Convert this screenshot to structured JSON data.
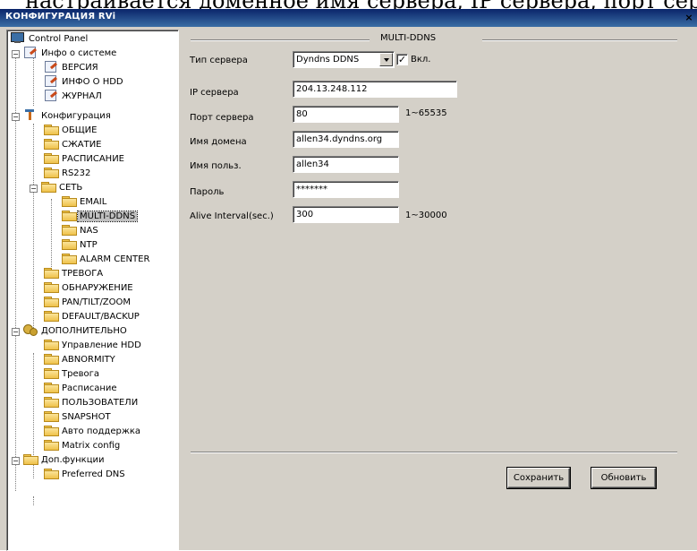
{
  "header_fragment": "настраивается доменное имя сервера, IP сервера, порт сервера",
  "window": {
    "title": "КОНФИГУРАЦИЯ RVi",
    "close_glyph": "×"
  },
  "tree": {
    "control_panel": "Control Panel",
    "system_info": "Инфо о системе",
    "version": "ВЕРСИЯ",
    "hdd_info": "ИНФО О HDD",
    "log": "ЖУРНАЛ",
    "config": "Конфигурация",
    "general": "ОБЩИЕ",
    "compression": "СЖАТИЕ",
    "schedule": "РАСПИСАНИЕ",
    "rs232": "RS232",
    "network": "СЕТЬ",
    "email": "EMAIL",
    "multi_ddns": "MULTI-DDNS",
    "nas": "NAS",
    "ntp": "NTP",
    "alarm_center": "ALARM CENTER",
    "alarm": "ТРЕВОГА",
    "detection": "ОБНАРУЖЕНИЕ",
    "ptz": "PAN/TILT/ZOOM",
    "default_backup": "DEFAULT/BACKUP",
    "advanced": "ДОПОЛНИТЕЛЬНО",
    "hdd_management": "Управление HDD",
    "abnormity": "ABNORMITY",
    "alarm_adv": "Тревога",
    "schedule_adv": "Расписание",
    "users": "ПОЛЬЗОВАТЕЛИ",
    "snapshot": "SNAPSHOT",
    "auto_maintain": "Авто поддержка",
    "matrix_config": "Matrix config",
    "extra_functions": "Доп.функции",
    "preferred_dns": "Preferred DNS"
  },
  "form": {
    "group_title": "MULTI-DDNS",
    "server_type_label": "Тип сервера",
    "server_type_value": "Dyndns DDNS",
    "enable_label": "Вкл.",
    "enable_checked": true,
    "server_ip_label": "IP сервера",
    "server_ip_value": "204.13.248.112",
    "server_port_label": "Порт сервера",
    "server_port_value": "80",
    "server_port_hint": "1~65535",
    "domain_label": "Имя домена",
    "domain_value": "allen34.dyndns.org",
    "username_label": "Имя польз.",
    "username_value": "allen34",
    "password_label": "Пароль",
    "password_value": "*******",
    "alive_label": "Alive Interval(sec.)",
    "alive_value": "300",
    "alive_hint": "1~30000",
    "check_glyph": "✓"
  },
  "buttons": {
    "save": "Сохранить",
    "refresh": "Обновить"
  }
}
